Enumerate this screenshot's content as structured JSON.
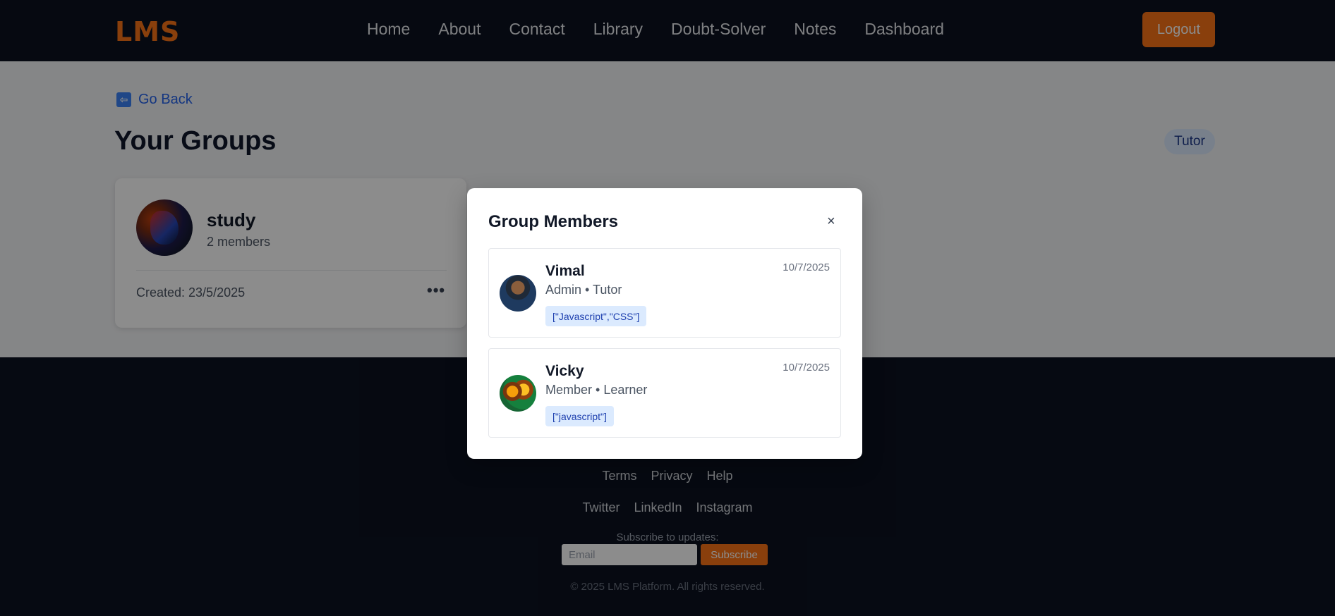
{
  "navbar": {
    "logo": "LMS",
    "links": [
      "Home",
      "About",
      "Contact",
      "Library",
      "Doubt-Solver",
      "Notes",
      "Dashboard"
    ],
    "logout_label": "Logout"
  },
  "main": {
    "go_back": "Go Back",
    "title": "Your Groups",
    "role_badge": "Tutor",
    "group": {
      "name": "study",
      "members": "2 members",
      "created": "Created: 23/5/2025",
      "menu": "•••"
    }
  },
  "modal": {
    "title": "Group Members",
    "close": "×",
    "members": [
      {
        "name": "Vimal",
        "role": "Admin • Tutor",
        "skills": "[\"Javascript\",\"CSS\"]",
        "date": "10/7/2025"
      },
      {
        "name": "Vicky",
        "role": "Member • Learner",
        "skills": "[\"javascript\"]",
        "date": "10/7/2025"
      }
    ]
  },
  "footer": {
    "links_row1": [
      "Terms",
      "Privacy",
      "Help"
    ],
    "links_row2": [
      "Twitter",
      "LinkedIn",
      "Instagram"
    ],
    "subscribe_label": "Subscribe to updates:",
    "email_placeholder": "Email",
    "subscribe_button": "Subscribe",
    "copyright": "© 2025 LMS Platform. All rights reserved."
  },
  "colors": {
    "brand": "#f97316",
    "dark_bg": "#0b1220",
    "link": "#2563eb",
    "badge_bg": "#dbeafe"
  },
  "icons": [
    "go-back-arrow-icon",
    "close-icon",
    "more-options-icon"
  ]
}
